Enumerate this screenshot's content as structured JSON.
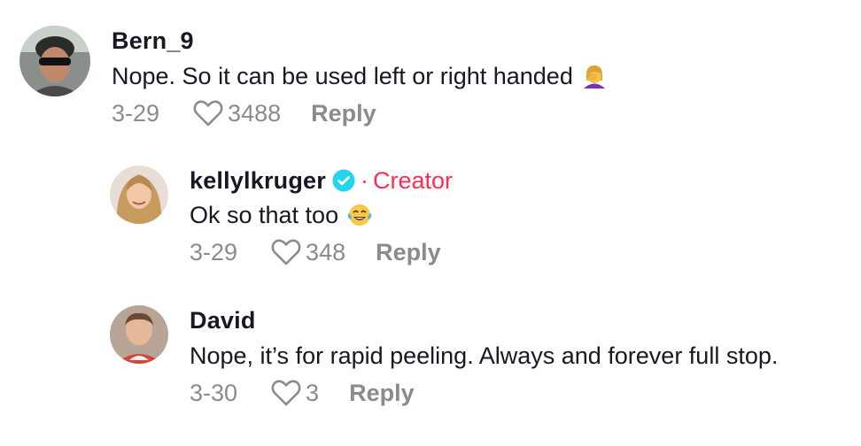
{
  "comments": [
    {
      "username": "Bern_9",
      "text": "Nope. So it can be used left or right handed",
      "emoji_icon": "woman-facepalming-emoji",
      "date": "3-29",
      "likes": "3488",
      "reply_label": "Reply"
    },
    {
      "username": "kellylkruger",
      "verified": true,
      "creator_dot": "·",
      "creator_label": "Creator",
      "text": "Ok so that too",
      "emoji_icon": "face-with-tears-of-joy-emoji",
      "date": "3-29",
      "likes": "348",
      "reply_label": "Reply"
    },
    {
      "username": "David",
      "text": "Nope, it’s for rapid peeling. Always and forever full stop.",
      "date": "3-30",
      "likes": "3",
      "reply_label": "Reply"
    }
  ],
  "colors": {
    "creator_accent": "#fe2c55",
    "verified_badge": "#20d5ec",
    "secondary_text": "#8a8b91",
    "primary_text": "#161823"
  }
}
